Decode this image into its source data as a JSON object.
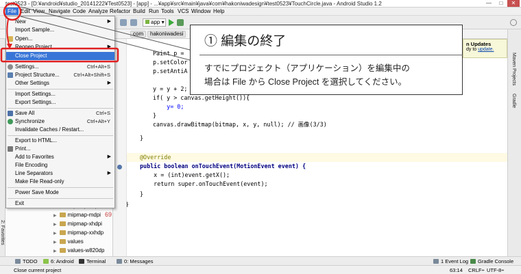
{
  "title_bar": {
    "title": "test0523 - [D:¥android¥studio_20141222¥Test0523] - [app] - ...¥app¥src¥main¥java¥com¥hakoniwadesign¥test0523¥TouchCircle.java - Android Studio 1.2",
    "minimize": "—",
    "maximize": "□",
    "close": "✕"
  },
  "menu_bar": {
    "items": [
      "File",
      "Edit",
      "View",
      "Navigate",
      "Code",
      "Analyze",
      "Refactor",
      "Build",
      "Run",
      "Tools",
      "VCS",
      "Window",
      "Help"
    ],
    "active": "File"
  },
  "toolbar": {
    "run_config": "app"
  },
  "nav_bar": {
    "crumbs": [
      "com",
      "hakoniwadesi"
    ]
  },
  "editor": {
    "tab": "TouchCircle.java",
    "line_number": "69",
    "lines": [
      "Paint p = ",
      "p.setColor",
      "p.setAntiA",
      "",
      "y = y + 2;",
      "if( y > canvas.getHeight()){",
      "    y= 0;",
      "}",
      "canvas.drawBitmap(bitmap, x, y, null); // 画像(3/3)",
      "}",
      "",
      "@Override",
      "public boolean onTouchEvent(MotionEvent event) {",
      "    x = (int)event.getX();",
      "    return super.onTouchEvent(event);",
      "}",
      "}"
    ]
  },
  "file_menu": {
    "items": [
      {
        "label": "New",
        "shortcut": "",
        "submenu": false
      },
      {
        "label": "Import Sample...",
        "shortcut": "",
        "submenu": false
      },
      {
        "label": "Open...",
        "shortcut": "",
        "submenu": false
      },
      {
        "label": "Reopen Project",
        "shortcut": "",
        "submenu": true
      },
      {
        "label": "Close Project",
        "shortcut": "",
        "submenu": false
      },
      {
        "label": "Settings...",
        "shortcut": "Ctrl+Alt+S",
        "submenu": false
      },
      {
        "label": "Project Structure...",
        "shortcut": "Ctrl+Alt+Shift+S",
        "submenu": false
      },
      {
        "label": "Other Settings",
        "shortcut": "",
        "submenu": true
      },
      {
        "label": "Import Settings...",
        "shortcut": "",
        "submenu": false
      },
      {
        "label": "Export Settings...",
        "shortcut": "",
        "submenu": false
      },
      {
        "label": "Save All",
        "shortcut": "Ctrl+S",
        "submenu": false
      },
      {
        "label": "Synchronize",
        "shortcut": "Ctrl+Alt+Y",
        "submenu": false
      },
      {
        "label": "Invalidate Caches / Restart...",
        "shortcut": "",
        "submenu": false
      },
      {
        "label": "Export to HTML...",
        "shortcut": "",
        "submenu": false
      },
      {
        "label": "Print...",
        "shortcut": "",
        "submenu": false
      },
      {
        "label": "Add to Favorites",
        "shortcut": "",
        "submenu": true
      },
      {
        "label": "File Encoding",
        "shortcut": "",
        "submenu": false
      },
      {
        "label": "Line Separators",
        "shortcut": "",
        "submenu": true
      },
      {
        "label": "Make File Read-only",
        "shortcut": "",
        "submenu": false
      },
      {
        "label": "Power Save Mode",
        "shortcut": "",
        "submenu": false
      },
      {
        "label": "Exit",
        "shortcut": "",
        "submenu": false
      }
    ],
    "selected": "Close Project"
  },
  "project_tree": {
    "items": [
      "mipmap-hdpi",
      "mipmap-mdpi",
      "mipmap-xhdpi",
      "mipmap-xxhdp",
      "values",
      "values-w820dp"
    ]
  },
  "side_tabs": {
    "right": [
      "Maven Projects",
      "Gradle"
    ],
    "left": [
      "2: Favorites"
    ]
  },
  "updates_popup": {
    "title": "Platform and Plugin Updates",
    "title_visible": "n Updates",
    "text": "dy to ",
    "link": "update."
  },
  "callout": {
    "title": "① 編集の終了",
    "body_line1": "すでにプロジェクト（アプリケーション）を編集中の",
    "body_line2": "場合は File から Close Project を選択してください。"
  },
  "bottom_tools": {
    "left": [
      "TODO",
      "6: Android",
      "Terminal",
      "0: Messages"
    ],
    "right": [
      "1 Event Log",
      "Gradle Console"
    ]
  },
  "status_bar": {
    "message": "Close current project",
    "position": "63:14",
    "separator": "CRLF÷",
    "encoding": "UTF-8÷"
  },
  "colors": {
    "menu_highlight": "#3875d7",
    "annotation_red": "#e02020",
    "keyword": "#000080",
    "number": "#0000ff"
  }
}
